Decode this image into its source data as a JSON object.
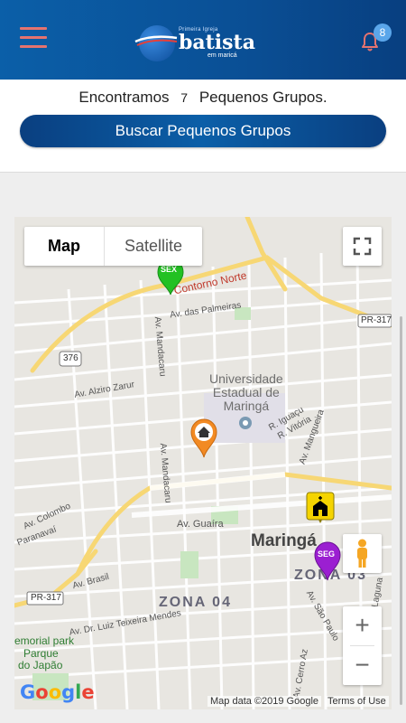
{
  "header": {
    "logo_top": "Primeira Igreja",
    "logo_main": "batista",
    "logo_sub": "em maricá",
    "notification_count": "8"
  },
  "summary": {
    "prefix": "Encontramos",
    "count": "7",
    "suffix": "Pequenos Grupos."
  },
  "search_button": "Buscar Pequenos Grupos",
  "map": {
    "type_map": "Map",
    "type_satellite": "Satellite",
    "zoom_in": "+",
    "zoom_out": "−",
    "attribution": "Map data ©2019 Google",
    "terms": "Terms of Use",
    "google_logo": "Google",
    "labels": {
      "contorno_norte": "Contorno Norte",
      "av_palmeiras": "Av. das Palmeiras",
      "mandacaru_1": "Av. Mandacaru",
      "mandacaru_2": "Av. Mandacaru",
      "pr317_top": "PR-317",
      "r376": "376",
      "university": "Universidade\nEstadual de\nMaringá",
      "alziro": "Av. Alziro Zarur",
      "iguacu": "R. Iguaçu",
      "vitoria": "R. Vitória",
      "mangueira": "Av. Mangueira",
      "colombo": "Av. Colombo",
      "paranavai": "Paranavaí",
      "guaira": "Av. Guaíra",
      "maringa": "Maringá",
      "zona03": "ZONA 03",
      "zona04": "ZONA 04",
      "brasil": "Av. Brasil",
      "pr317_bottom": "PR-317",
      "luiz_teixeira": "Av. Dr. Luiz Teixeira Mendes",
      "memorial": "emorial park",
      "parque1": "Parque",
      "parque2": "do Japão",
      "sao_paulo": "Av. São Paulo",
      "cerro_az": "Av. Cerro Az",
      "laguna": "Laguna"
    },
    "markers": [
      {
        "label": "SEX",
        "color": "#23c123"
      },
      {
        "label": "SEG",
        "color": "#9b1fd1"
      }
    ]
  }
}
